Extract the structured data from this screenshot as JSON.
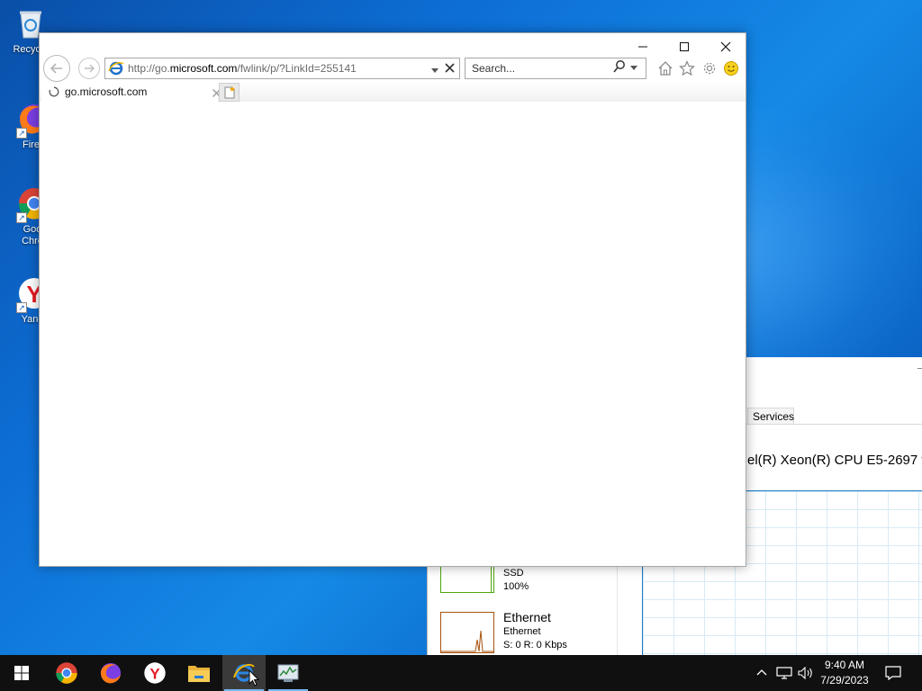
{
  "desktop": {
    "icons": [
      {
        "label": "Recycle"
      },
      {
        "label": "Firef"
      },
      {
        "label": "Goo",
        "label2": "Chro"
      },
      {
        "label": "Yand"
      }
    ]
  },
  "browser": {
    "url_prefix": "http://go.",
    "url_domain": "microsoft.com",
    "url_suffix": "/fwlink/p/?LinkId=255141",
    "search_placeholder": "Search...",
    "tab_title": "go.microsoft.com",
    "controls": {
      "minimize": "—",
      "maximize": "☐",
      "close": "✕"
    }
  },
  "task_manager": {
    "tab_services": "Services",
    "cpu_name": "el(R) Xeon(R) CPU E5-2697 v",
    "disk_label": "SSD",
    "disk_value": "100%",
    "net_title": "Ethernet",
    "net_sub": "Ethernet",
    "net_rates": "S: 0 R: 0 Kbps"
  },
  "taskbar": {
    "time": "9:40 AM",
    "date": "7/29/2023",
    "active_app": "internet-explorer"
  },
  "colors": {
    "accent": "#76b9ed",
    "taskbar": "#101010",
    "ie_blue": "#1e6fc8"
  }
}
